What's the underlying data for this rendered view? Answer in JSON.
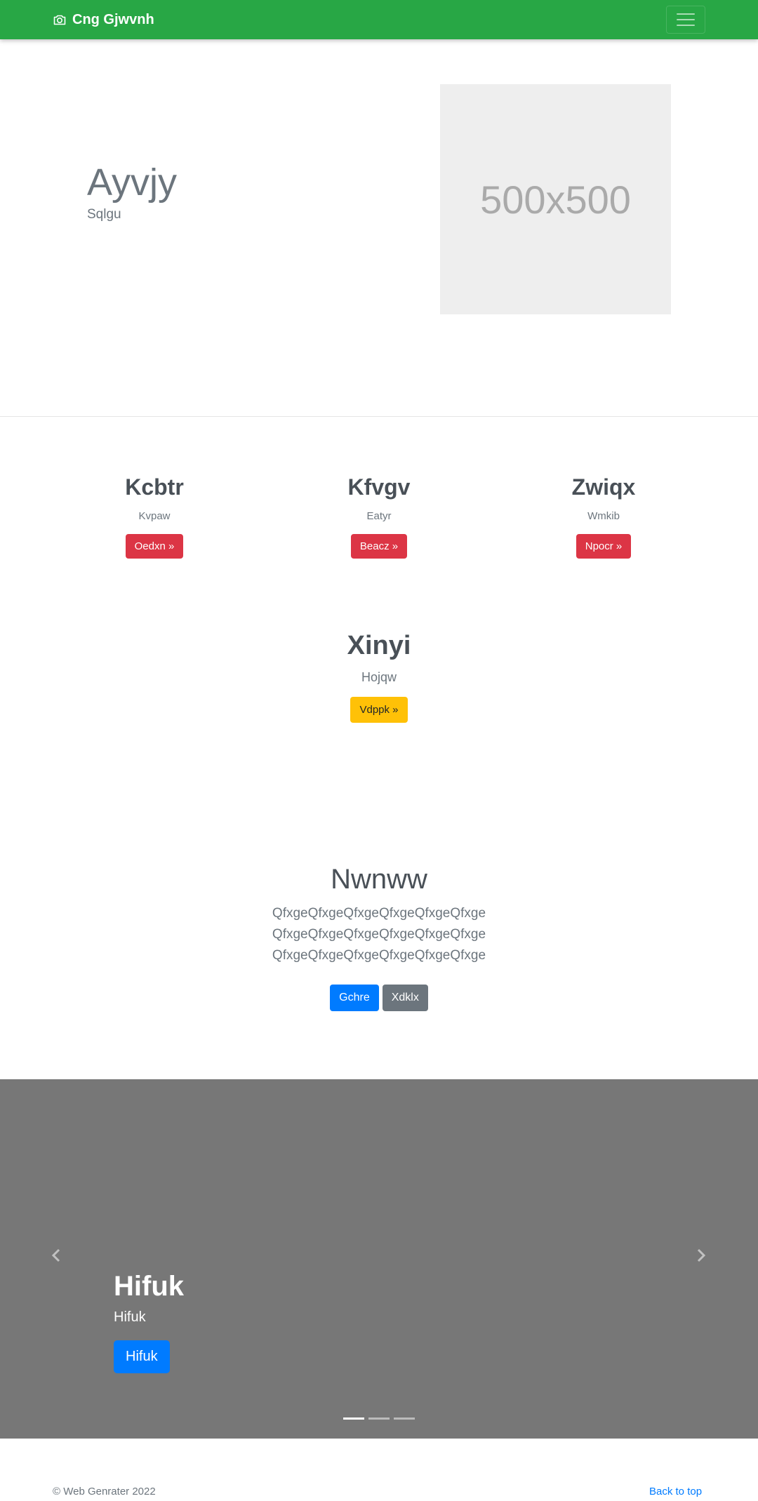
{
  "navbar": {
    "brand": "Cng Gjwvnh",
    "brand_icon": "camera-icon",
    "toggler_icon": "hamburger-icon",
    "color": "#28a745"
  },
  "hero": {
    "title": "Ayvjy",
    "subtitle": "Sqlgu",
    "image_label": "500x500"
  },
  "features": [
    {
      "title": "Kcbtr",
      "text": "Kvpaw",
      "button": "Oedxn »"
    },
    {
      "title": "Kfvgv",
      "text": "Eatyr",
      "button": "Beacz »"
    },
    {
      "title": "Zwiqx",
      "text": "Wmkib",
      "button": "Npocr »"
    }
  ],
  "feature_center": {
    "title": "Xinyi",
    "text": "Hojqw",
    "button": "Vdppk »"
  },
  "callout": {
    "title": "Nwnww",
    "lines": [
      "QfxgeQfxgeQfxgeQfxgeQfxgeQfxge",
      "QfxgeQfxgeQfxgeQfxgeQfxgeQfxge",
      "QfxgeQfxgeQfxgeQfxgeQfxgeQfxge"
    ],
    "primary_button": "Gchre",
    "secondary_button": "Xdklx"
  },
  "carousel": {
    "title": "Hifuk",
    "text": "Hifuk",
    "button": "Hifuk",
    "prev_icon": "chevron-left-icon",
    "next_icon": "chevron-right-icon",
    "slides": 3,
    "active_slide": 1
  },
  "footer": {
    "copyright": "© Web Genrater 2022",
    "back_to_top": "Back to top"
  }
}
